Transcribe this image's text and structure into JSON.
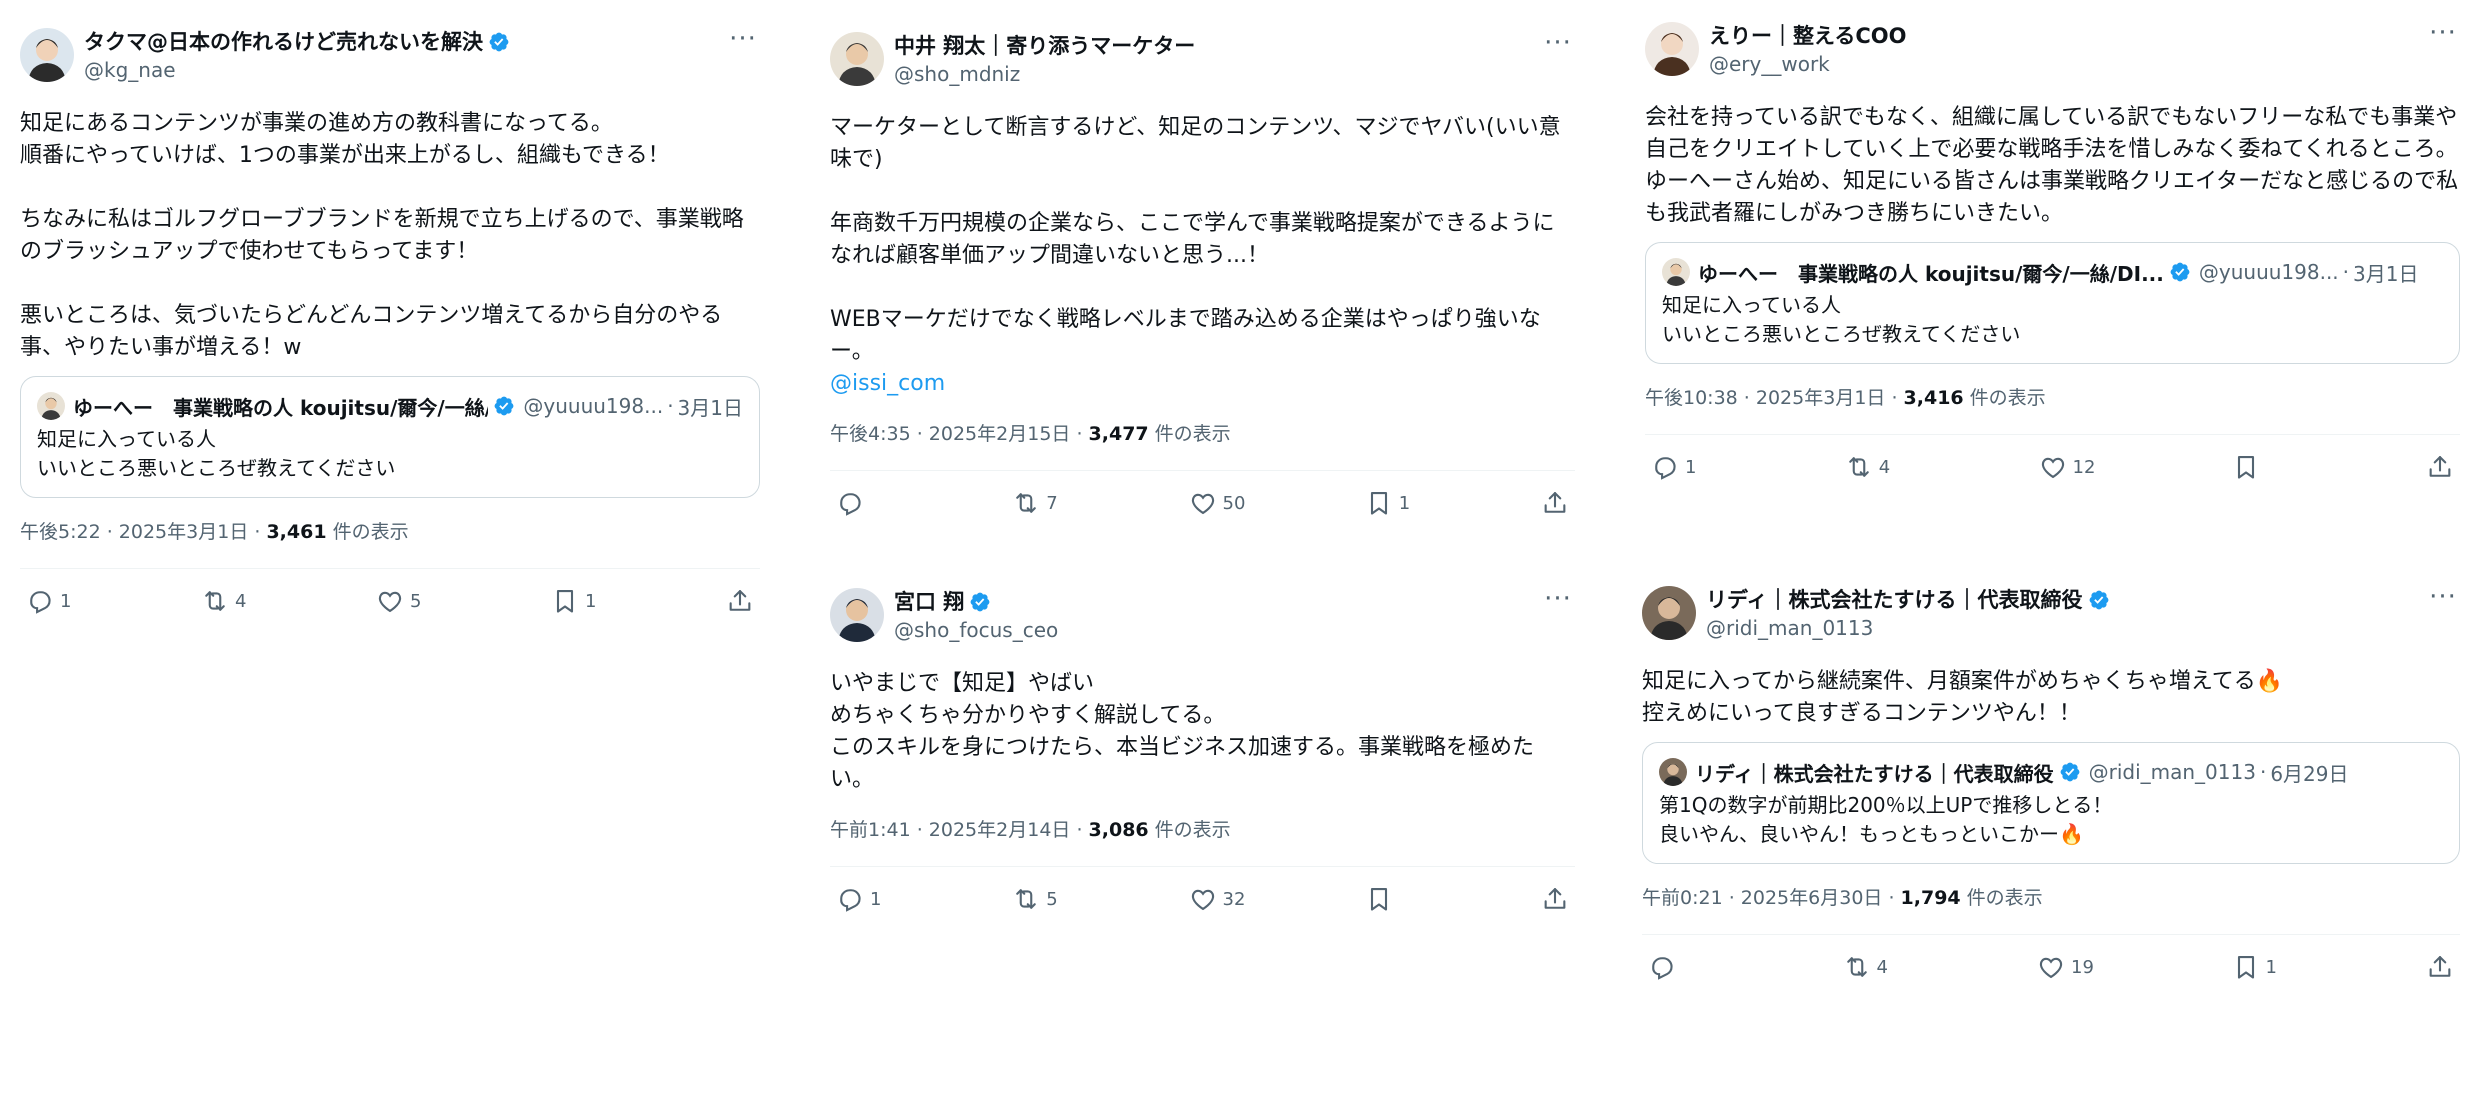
{
  "colors": {
    "accent": "#1d9bf0",
    "muted": "#536471",
    "text": "#0f1419",
    "border": "#cfd9de"
  },
  "tweets": [
    {
      "display_name": "タクマ@日本の作れるけど売れないを解決",
      "verified": true,
      "handle": "@kg_nae",
      "more_icon": "···",
      "body": "知足にあるコンテンツが事業の進め方の教科書になってる。\n順番にやっていけば、1つの事業が出来上がるし、組織もできる！\n\nちなみに私はゴルフグローブブランドを新規で立ち上げるので、事業戦略のブラッシュアップで使わせてもらってます！\n\n悪いところは、気づいたらどんどんコンテンツ増えてるから自分のやる事、やりたい事が増える！w",
      "link": "",
      "quote": {
        "name": "ゆーへー　事業戦略の人 koujitsu/爾今/一絲/DI...",
        "verified": true,
        "handle": "@yuuuu198...",
        "dot": "·",
        "date": "3月1日",
        "body": "知足に入っている人\nいいところ悪いところぜ教えてください"
      },
      "time": "午後5:22 · 2025年3月1日 · ",
      "views": "3,461",
      "views_label": " 件の表示",
      "actions": {
        "reply": "1",
        "retweet": "4",
        "like": "5",
        "bookmark": "1"
      }
    },
    {
      "display_name": "中井 翔太｜寄り添うマーケター",
      "verified": false,
      "handle": "@sho_mdniz",
      "more_icon": "···",
      "body": "マーケターとして断言するけど、知足のコンテンツ、マジでヤバい(いい意味で)\n\n年商数千万円規模の企業なら、ここで学んで事業戦略提案ができるようになれば顧客単価アップ間違いないと思う...！\n\nWEBマーケだけでなく戦略レベルまで踏み込める企業はやっぱり強いなー。",
      "link": "@issi_com",
      "time": "午後4:35 · 2025年2月15日 · ",
      "views": "3,477",
      "views_label": " 件の表示",
      "actions": {
        "reply": "",
        "retweet": "7",
        "like": "50",
        "bookmark": "1"
      }
    },
    {
      "display_name": "宮口 翔",
      "verified": true,
      "handle": "@sho_focus_ceo",
      "more_icon": "···",
      "body": "いやまじで【知足】やばい\nめちゃくちゃ分かりやすく解説してる。\nこのスキルを身につけたら、本当ビジネス加速する。事業戦略を極めたい。",
      "link": "",
      "time": "午前1:41 · 2025年2月14日 · ",
      "views": "3,086",
      "views_label": " 件の表示",
      "actions": {
        "reply": "1",
        "retweet": "5",
        "like": "32",
        "bookmark": ""
      }
    },
    {
      "display_name": "えりー｜整えるCOO",
      "verified": false,
      "handle": "@ery__work",
      "more_icon": "···",
      "body": "会社を持っている訳でもなく、組織に属している訳でもないフリーな私でも事業や自己をクリエイトしていく上で必要な戦略手法を惜しみなく委ねてくれるところ。ゆーへーさん始め、知足にいる皆さんは事業戦略クリエイターだなと感じるので私も我武者羅にしがみつき勝ちにいきたい。",
      "link": "",
      "quote": {
        "name": "ゆーへー　事業戦略の人 koujitsu/爾今/一絲/DI...",
        "verified": true,
        "handle": "@yuuuu198...",
        "dot": "·",
        "date": "3月1日",
        "body": "知足に入っている人\nいいところ悪いところぜ教えてください"
      },
      "time": "午後10:38 · 2025年3月1日 · ",
      "views": "3,416",
      "views_label": " 件の表示",
      "actions": {
        "reply": "1",
        "retweet": "4",
        "like": "12",
        "bookmark": ""
      }
    },
    {
      "display_name": "リディ｜株式会社たすける｜代表取締役",
      "verified": true,
      "handle": "@ridi_man_0113",
      "more_icon": "···",
      "body": "知足に入ってから継続案件、月額案件がめちゃくちゃ増えてる🔥\n控えめにいって良すぎるコンテンツやん！！",
      "link": "",
      "quote": {
        "name": "リディ｜株式会社たすける｜代表取締役",
        "verified": true,
        "handle": "@ridi_man_0113",
        "dot": "·",
        "date": "6月29日",
        "body": "第1Qの数字が前期比200％以上UPで推移しとる！\n良いやん、良いやん！もっともっといこかー🔥"
      },
      "time": "午前0:21 · 2025年6月30日 · ",
      "views": "1,794",
      "views_label": " 件の表示",
      "actions": {
        "reply": "",
        "retweet": "4",
        "like": "19",
        "bookmark": "1"
      }
    }
  ]
}
